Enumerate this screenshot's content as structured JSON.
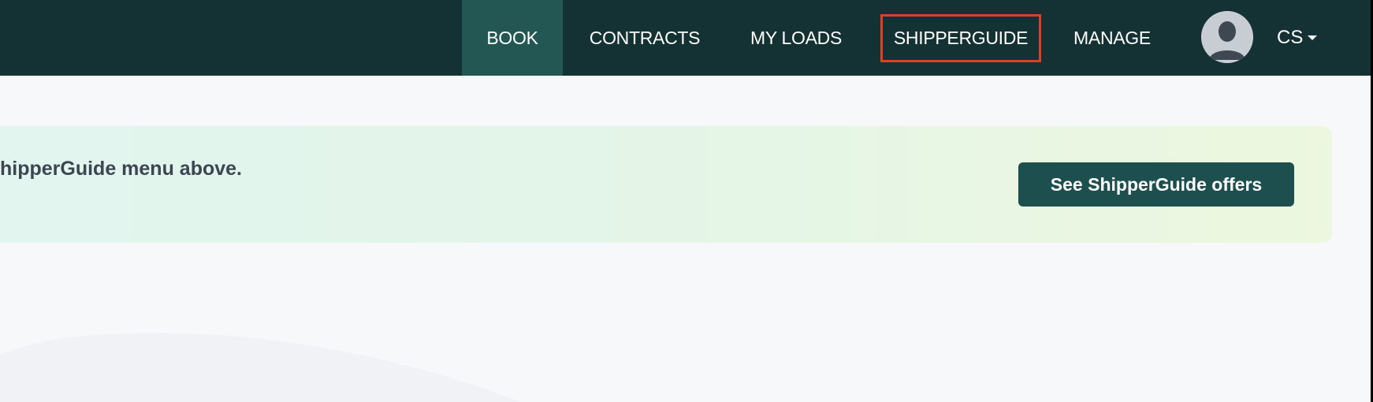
{
  "nav": {
    "book": "BOOK",
    "contracts": "CONTRACTS",
    "my_loads": "MY LOADS",
    "shipperguide": "SHIPPERGUIDE",
    "manage": "MANAGE"
  },
  "user": {
    "initials": "CS",
    "avatar_icon": "user-avatar-icon",
    "menu_icon": "caret-down-icon"
  },
  "banner": {
    "text": "hipperGuide menu above.",
    "button_label": "See ShipperGuide offers"
  },
  "colors": {
    "navbar": "#143134",
    "active_tab": "#235754",
    "highlight_border": "#e53d24",
    "button": "#1d4f4f",
    "page_background": "#f7f8fa"
  }
}
